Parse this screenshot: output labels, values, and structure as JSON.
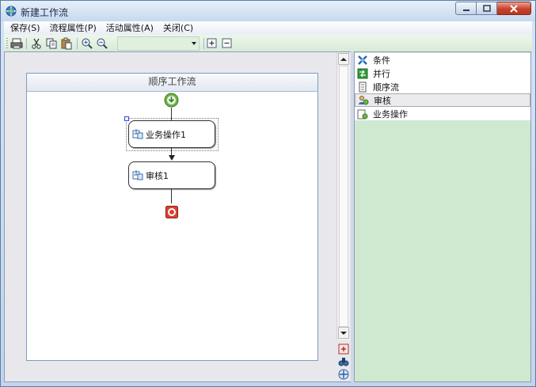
{
  "window": {
    "title": "新建工作流",
    "icon": "workflow-app-icon"
  },
  "menu": [
    {
      "label": "保存(S)"
    },
    {
      "label": "流程属性(P)"
    },
    {
      "label": "活动属性(A)"
    },
    {
      "label": "关闭(C)"
    }
  ],
  "toolbar": {
    "icons": [
      "print-icon",
      "cut-icon",
      "copy-icon",
      "paste-icon",
      "zoom-in-icon",
      "zoom-out-icon",
      "expand-icon",
      "collapse-icon"
    ],
    "zoom_value": ""
  },
  "workflow": {
    "title": "顺序工作流",
    "activities": [
      {
        "label": "业务操作1"
      },
      {
        "label": "审核1"
      }
    ]
  },
  "toolbox": {
    "items": [
      {
        "label": "条件",
        "icon": "condition-icon"
      },
      {
        "label": "并行",
        "icon": "parallel-icon"
      },
      {
        "label": "顺序流",
        "icon": "sequence-icon"
      },
      {
        "label": "审核",
        "icon": "review-icon"
      },
      {
        "label": "业务操作",
        "icon": "business-operation-icon"
      }
    ],
    "selected_index": 3
  },
  "colors": {
    "toolbox_bg": "#cfe9d0",
    "workflow_border": "#7f9cc0",
    "close_button": "#c7432b",
    "start_node": "#6bb54a",
    "end_node": "#d8432e"
  }
}
